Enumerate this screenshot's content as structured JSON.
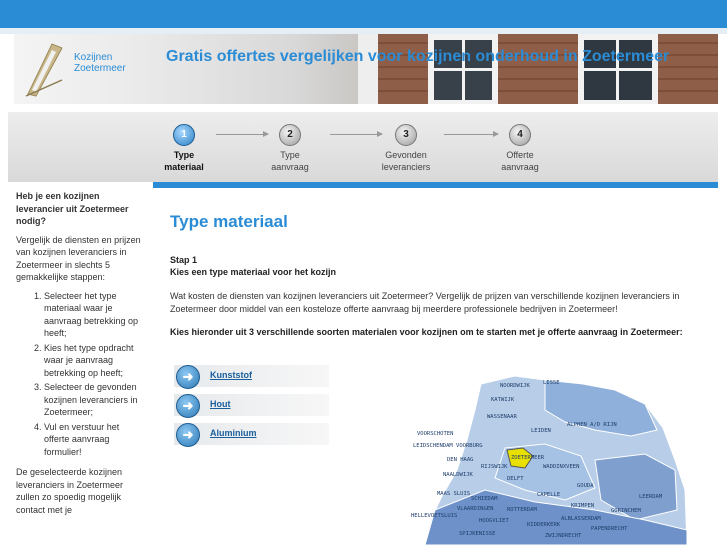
{
  "header": {
    "logo_line1": "Kozijnen",
    "logo_line2": "Zoetermeer",
    "title": "Gratis offertes vergelijken voor kozijnen onderhoud in Zoetermeer"
  },
  "steps": [
    {
      "number": "1",
      "line1": "Type",
      "line2": "materiaal",
      "active": true
    },
    {
      "number": "2",
      "line1": "Type",
      "line2": "aanvraag",
      "active": false
    },
    {
      "number": "3",
      "line1": "Gevonden",
      "line2": "leveranciers",
      "active": false
    },
    {
      "number": "4",
      "line1": "Offerte",
      "line2": "aanvraag",
      "active": false
    }
  ],
  "sidebar": {
    "heading": "Heb je een kozijnen leverancier uit Zoetermeer nodig?",
    "intro": "Vergelijk de diensten en prijzen van kozijnen leveranciers in Zoetermeer in slechts 5 gemakkelijke stappen:",
    "items": [
      "Selecteer het type materiaal waar je aanvraag betrekking op heeft;",
      "Kies het type opdracht waar je aanvraag betrekking op heeft;",
      "Selecteer de gevonden kozijnen leveranciers in Zoetermeer;",
      "Vul en verstuur het offerte aanvraag formulier!"
    ],
    "outro": "De geselecteerde kozijnen leveranciers in Zoetermeer zullen zo spoedig mogelijk contact met je"
  },
  "main": {
    "title": "Type materiaal",
    "step_number": "Stap 1",
    "step_title": "Kies een type materiaal voor het kozijn",
    "body": "Wat kosten de diensten van kozijnen leveranciers uit Zoetermeer? Vergelijk de prijzen van verschillende kozijnen leveranciers in Zoetermeer door middel van een kosteloze offerte aanvraag bij meerdere professionele bedrijven in Zoetermeer!",
    "instruction": "Kies hieronder uit 3 verschillende soorten materialen voor kozijnen om te starten met je offerte aanvraag in Zoetermeer:"
  },
  "options": [
    "Kunststof",
    "Hout",
    "Aluminium"
  ],
  "map": {
    "highlight_color": "#e8e000",
    "places": [
      "NOORDWIJK",
      "LISSE",
      "KATWIJK",
      "WASSENAAR",
      "LEIDEN",
      "ALPHEN A/D RIJN",
      "VOORSCHOTEN",
      "LEIDSCHENDAM VOORBURG",
      "ZOETERMEER",
      "WADDINXVEEN",
      "DEN HAAG",
      "RIJSWIJK",
      "NAALDWIJK",
      "DELFT",
      "GOUDA",
      "MAAS SLUIS",
      "SCHIEDAM",
      "CAPELLE",
      "LEERDAM",
      "VLAARDINGEN",
      "ROTTERDAM",
      "KRIMPEN",
      "GORINCHEM",
      "HELLEVOETSLUIS",
      "HOOGVLIET",
      "ALBLASSERDAM",
      "RIDDERKERK",
      "PAPENDRECHT",
      "SPIJKENISSE",
      "ZWIJNDRECHT"
    ]
  },
  "colors": {
    "accent": "#2b8cd6",
    "link": "#1a5e9c"
  }
}
